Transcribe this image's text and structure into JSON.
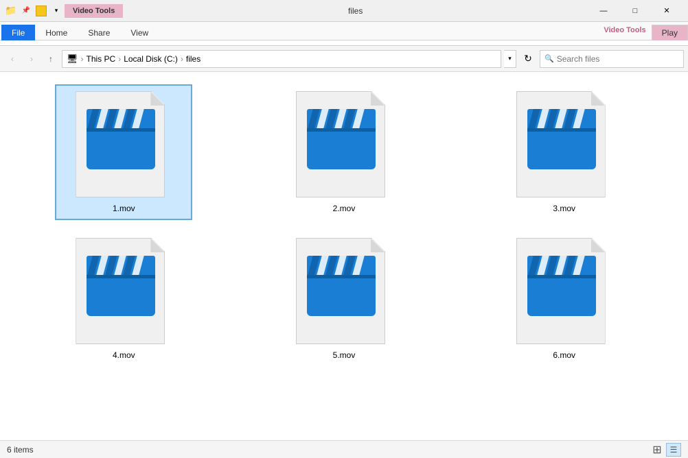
{
  "titlebar": {
    "title": "files",
    "video_tools_label": "Video Tools",
    "minimize": "—",
    "maximize": "□",
    "close": "✕"
  },
  "ribbon": {
    "tabs": [
      {
        "id": "file",
        "label": "File",
        "type": "file"
      },
      {
        "id": "home",
        "label": "Home",
        "type": "normal"
      },
      {
        "id": "share",
        "label": "Share",
        "type": "normal"
      },
      {
        "id": "view",
        "label": "View",
        "type": "normal"
      },
      {
        "id": "play",
        "label": "Play",
        "type": "play"
      }
    ],
    "video_tools_label": "Video Tools"
  },
  "addressbar": {
    "back": "‹",
    "forward": "›",
    "up": "↑",
    "breadcrumb": [
      {
        "label": "This PC"
      },
      {
        "label": "Local Disk (C:)"
      },
      {
        "label": "files"
      }
    ],
    "search_placeholder": "Search files",
    "search_label": "Search"
  },
  "files": [
    {
      "id": 1,
      "name": "1.mov"
    },
    {
      "id": 2,
      "name": "2.mov"
    },
    {
      "id": 3,
      "name": "3.mov"
    },
    {
      "id": 4,
      "name": "4.mov"
    },
    {
      "id": 5,
      "name": "5.mov"
    },
    {
      "id": 6,
      "name": "6.mov"
    }
  ],
  "statusbar": {
    "count_text": "6 items"
  },
  "colors": {
    "accent_blue": "#1a7fd4",
    "file_blue": "#1a73e8",
    "video_tab_pink": "#e8b4c8"
  }
}
